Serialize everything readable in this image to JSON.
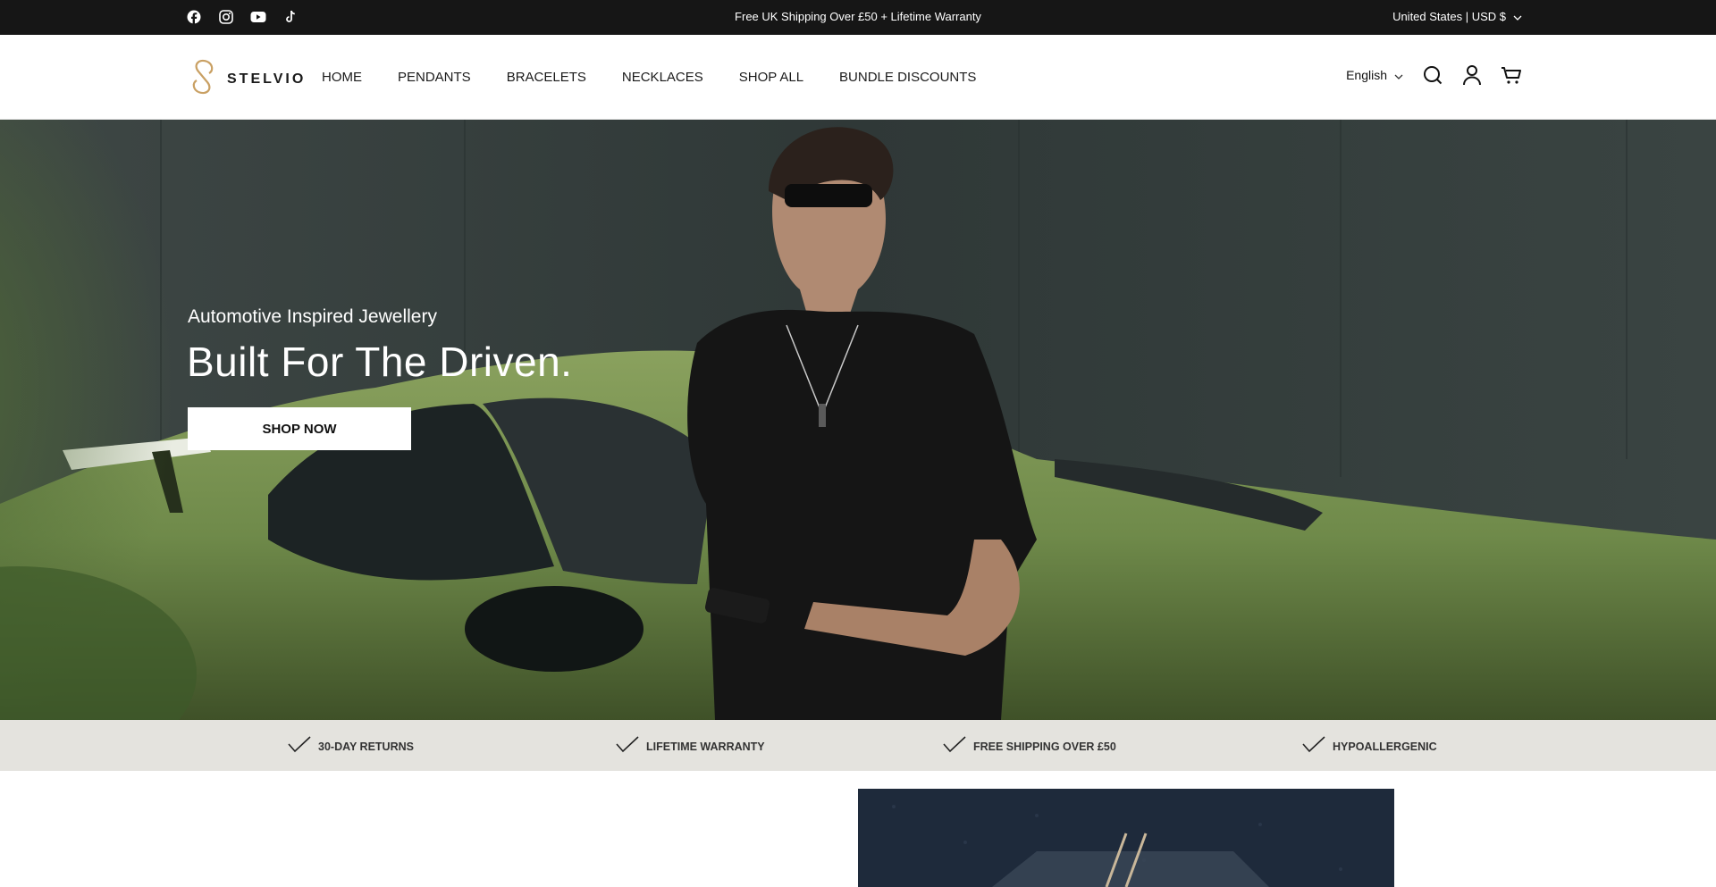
{
  "announcement": {
    "text": "Free UK Shipping Over £50 + Lifetime Warranty",
    "social_icons": [
      "facebook-icon",
      "instagram-icon",
      "youtube-icon",
      "tiktok-icon"
    ],
    "locale_label": "United States | USD $"
  },
  "header": {
    "logo_text": "STELVIO",
    "nav": [
      "HOME",
      "PENDANTS",
      "BRACELETS",
      "NECKLACES",
      "SHOP ALL",
      "BUNDLE DISCOUNTS"
    ],
    "language": "English",
    "icons": [
      "search-icon",
      "account-icon",
      "cart-icon"
    ]
  },
  "hero": {
    "subtitle": "Automotive Inspired Jewellery",
    "title": "Built For The Driven.",
    "button": "SHOP NOW"
  },
  "features": [
    "30-DAY RETURNS",
    "LIFETIME WARRANTY",
    "FREE SHIPPING OVER £50",
    "HYPOALLERGENIC"
  ],
  "colors": {
    "topbar": "#161616",
    "strip": "#e4e3de",
    "logo_gold": "#c9a063",
    "car_green": "#6f8a4a"
  }
}
